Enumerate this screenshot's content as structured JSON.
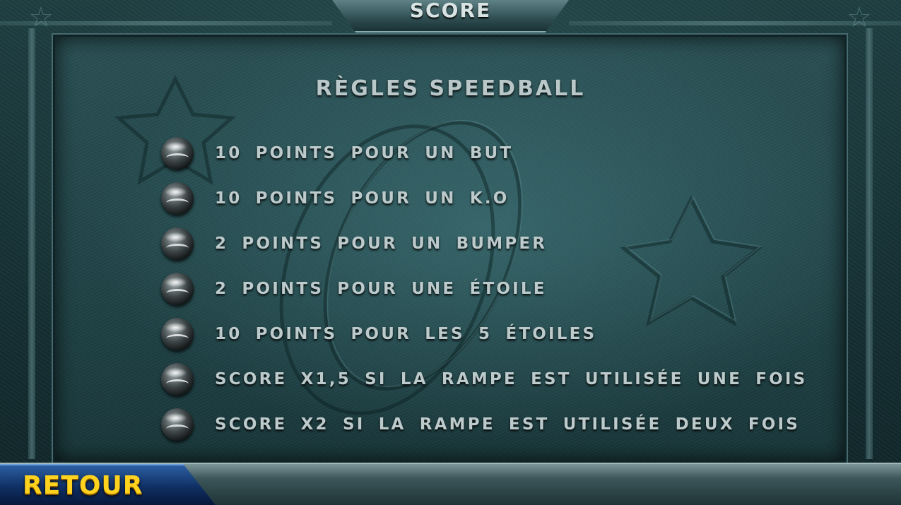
{
  "header": {
    "score_label": "SCORE"
  },
  "rules": {
    "title": "RÈGLES SPEEDBALL",
    "items": [
      {
        "text": "10 POINTS POUR UN BUT",
        "icon": "ball-icon"
      },
      {
        "text": "10 POINTS POUR UN K.O",
        "icon": "ball-icon"
      },
      {
        "text": "2 POINTS POUR UN BUMPER",
        "icon": "ball-icon"
      },
      {
        "text": "2 POINTS POUR UNE ÉTOILE",
        "icon": "ball-icon"
      },
      {
        "text": "10 POINTS POUR LES 5 ÉTOILES",
        "icon": "ball-icon"
      },
      {
        "text": "SCORE X1,5 SI LA RAMPE EST UTILISÉE UNE FOIS",
        "icon": "ball-icon"
      },
      {
        "text": "SCORE X2 SI LA RAMPE EST UTILISÉE DEUX FOIS",
        "icon": "ball-icon"
      }
    ]
  },
  "footer": {
    "back_label": "RETOUR"
  },
  "colors": {
    "back_label": "#ffd21e",
    "back_button": "#0f2f63",
    "rule_text": "#bccacb",
    "board": "#23474b"
  }
}
